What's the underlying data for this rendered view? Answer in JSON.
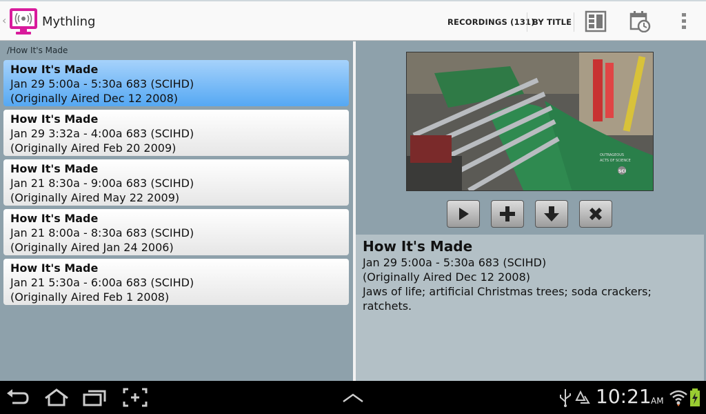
{
  "app": {
    "title": "Mythling"
  },
  "actionbar": {
    "recordings_label": "RECORDINGS (131)",
    "sort_label": "BY TITLE"
  },
  "breadcrumb": "/How It's Made",
  "list": [
    {
      "title": "How It's Made",
      "time": "Jan 29 5:00a - 5:30a 683 (SCIHD)",
      "aired": "(Originally Aired Dec 12 2008)",
      "selected": true
    },
    {
      "title": "How It's Made",
      "time": "Jan 29 3:32a - 4:00a 683 (SCIHD)",
      "aired": "(Originally Aired Feb 20 2009)",
      "selected": false
    },
    {
      "title": "How It's Made",
      "time": "Jan 21 8:30a - 9:00a 683 (SCIHD)",
      "aired": "(Originally Aired May 22 2009)",
      "selected": false
    },
    {
      "title": "How It's Made",
      "time": "Jan 21 8:00a - 8:30a 683 (SCIHD)",
      "aired": "(Originally Aired Jan 24 2006)",
      "selected": false
    },
    {
      "title": "How It's Made",
      "time": "Jan 21 5:30a - 6:00a 683 (SCIHD)",
      "aired": "(Originally Aired Feb 1 2008)",
      "selected": false
    }
  ],
  "detail": {
    "title": "How It's Made",
    "time": "Jan 29 5:00a - 5:30a 683 (SCIHD)",
    "aired": "(Originally Aired Dec 12 2008)",
    "description": "Jaws of life; artificial Christmas trees; soda crackers; ratchets."
  },
  "controls": [
    "play-icon",
    "add-icon",
    "download-icon",
    "delete-icon"
  ],
  "status": {
    "time": "10:21",
    "ampm": "AM"
  },
  "colors": {
    "selected_top": "#a6d2fb",
    "selected_bottom": "#55a8f3",
    "app_icon": "#d81b9c"
  }
}
